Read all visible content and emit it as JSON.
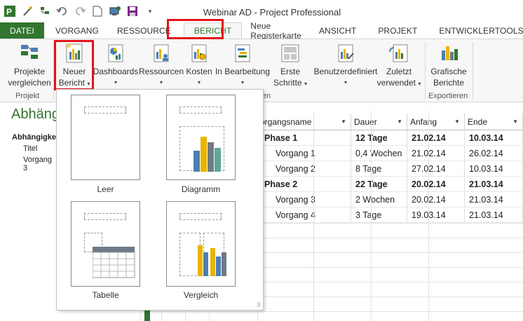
{
  "window": {
    "title": "Webinar AD - Project Professional"
  },
  "colors": {
    "accent": "#31752f",
    "highlight": "#e3141c"
  },
  "qat": [
    "project-logo-icon",
    "wand-icon",
    "outline-icon",
    "undo-icon",
    "redo-icon",
    "new-doc-icon",
    "pc-icon",
    "save-icon",
    "dropdown-icon"
  ],
  "tabs": [
    "DATEI",
    "VORGANG",
    "RESSOURCE",
    "BERICHT",
    "Neue Registerkarte",
    "ANSICHT",
    "PROJEKT",
    "ENTWICKLERTOOLS"
  ],
  "ribbon": {
    "compare": [
      "Projekte",
      "vergleichen"
    ],
    "new_report": [
      "Neuer",
      "Bericht"
    ],
    "dashboards": "Dashboards",
    "resources": "Ressourcen",
    "costs": "Kosten",
    "in_progress": "In Bearbeitung",
    "first_steps": [
      "Erste",
      "Schritte"
    ],
    "custom": "Benutzerdefiniert",
    "recent": [
      "Zuletzt",
      "verwendet"
    ],
    "graphic": [
      "Grafische",
      "Berichte"
    ],
    "group_project": "Projekt",
    "group_reports_partial": "en",
    "group_export": "Exportieren"
  },
  "view": {
    "title": "Abhäng",
    "left_head": "Abhängigke",
    "left_item1": "Titel",
    "left_item2a": "Vorgang",
    "left_item2b": "3"
  },
  "gallery": {
    "blank": "Leer",
    "chart": "Diagramm",
    "table": "Tabelle",
    "compare": "Vergleich"
  },
  "table": {
    "headers": [
      "organgsname",
      "Dauer",
      "Anfang",
      "Ende"
    ],
    "rows": [
      [
        "Phase 1",
        "12 Tage",
        "21.02.14",
        "10.03.14"
      ],
      [
        "Vorgang 1",
        "0,4 Wochen",
        "21.02.14",
        "26.02.14"
      ],
      [
        "Vorgang 2",
        "8 Tage",
        "27.02.14",
        "10.03.14"
      ],
      [
        "Phase 2",
        "22 Tage",
        "20.02.14",
        "21.03.14"
      ],
      [
        "Vorgang 3",
        "2 Wochen",
        "20.02.14",
        "21.03.14"
      ],
      [
        "Vorgang 4",
        "3 Tage",
        "19.03.14",
        "21.03.14"
      ]
    ]
  }
}
